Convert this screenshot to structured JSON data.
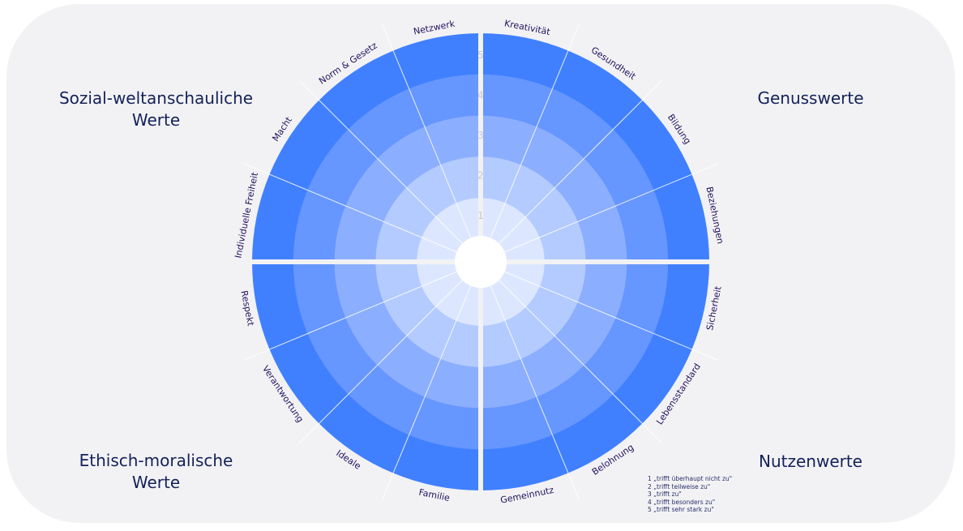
{
  "quadrants": {
    "top_left": {
      "title_line1": "Sozial-weltanschauliche",
      "title_line2": "Werte"
    },
    "top_right": {
      "title_line1": "Genusswerte"
    },
    "bottom_left": {
      "title_line1": "Ethisch-moralische",
      "title_line2": "Werte"
    },
    "bottom_right": {
      "title_line1": "Nutzenwerte"
    }
  },
  "segments": {
    "top_left": [
      "Individuelle Freiheit",
      "Macht",
      "Norm & Gesetz",
      "Netzwerk"
    ],
    "top_right": [
      "Kreativität",
      "Gesundheit",
      "Bildung",
      "Beziehungen"
    ],
    "bottom_right": [
      "Sicherheit",
      "Lebensstandard",
      "Belohnung",
      "Gemeinnutz"
    ],
    "bottom_left": [
      "Familie",
      "Ideale",
      "Verantwortung",
      "Respekt"
    ]
  },
  "scale_numbers": [
    "1",
    "2",
    "3",
    "4",
    "5"
  ],
  "legend": [
    "1 „trifft überhaupt nicht zu\"",
    "2 „trifft teilweise zu\"",
    "3 „trifft zu\"",
    "4 „trifft besonders zu\"",
    "5 „trifft sehr stark zu\""
  ],
  "colors": {
    "ring1": "#dce7ff",
    "ring2": "#b4cbff",
    "ring3": "#8caeff",
    "ring4": "#6696ff",
    "ring5": "#4080ff",
    "background": "#f2f2f4",
    "text": "#14215a"
  }
}
